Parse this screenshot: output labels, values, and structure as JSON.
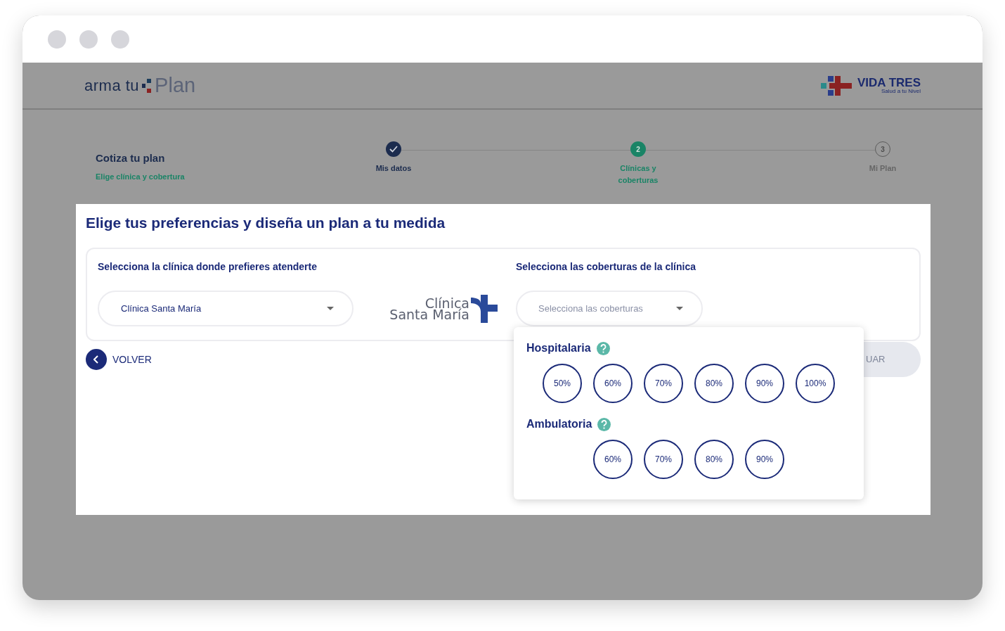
{
  "header": {
    "logo_left": {
      "text": "arma tu",
      "accent": "Plan"
    },
    "logo_right": {
      "name": "VIDA TRES",
      "tagline": "Salud a tu Nivel"
    }
  },
  "progress": {
    "title": "Cotiza tu plan",
    "subtitle": "Elige clínica y cobertura",
    "steps": [
      {
        "label": "Mis datos",
        "done": true,
        "current": false
      },
      {
        "label": "Clínicas y coberturas",
        "number": "2",
        "done": false,
        "current": true
      },
      {
        "label": "Mi Plan",
        "number": "3",
        "done": false,
        "current": false
      }
    ]
  },
  "panel": {
    "title": "Elige tus preferencias y diseña un plan a tu medida",
    "clinic": {
      "label": "Selecciona la clínica donde prefieres atenderte",
      "value": "Clínica Santa María",
      "logo_lines": [
        "Clínica",
        "Santa María"
      ]
    },
    "coverage": {
      "label": "Selecciona las coberturas de la clínica",
      "placeholder": "Selecciona las coberturas"
    },
    "popover": {
      "groups": [
        {
          "title": "Hospitalaria",
          "options": [
            {
              "label": "50%",
              "selected": false
            },
            {
              "label": "60%",
              "selected": false
            },
            {
              "label": "70%",
              "selected": false
            },
            {
              "label": "80%",
              "selected": false
            },
            {
              "label": "90%",
              "selected": false
            },
            {
              "label": "100%",
              "selected": false
            }
          ]
        },
        {
          "title": "Ambulatoria",
          "options": [
            {
              "label": "60%",
              "selected": false
            },
            {
              "label": "70%",
              "selected": false
            },
            {
              "label": "80%",
              "selected": false
            },
            {
              "label": "90%",
              "selected": false
            }
          ]
        }
      ]
    },
    "back_button": "VOLVER",
    "next_button": "UAR"
  }
}
